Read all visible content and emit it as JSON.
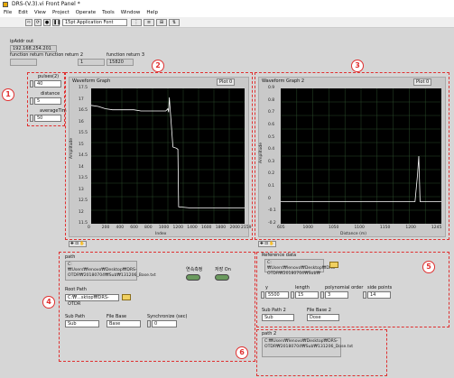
{
  "window": {
    "title": "DRS-(V.3).vi Front Panel *"
  },
  "menu": [
    "File",
    "Edit",
    "View",
    "Project",
    "Operate",
    "Tools",
    "Window",
    "Help"
  ],
  "toolbar": {
    "font_select": "15pt Application Font"
  },
  "ipaddr": {
    "label": "ipAddr out",
    "value": "192.168.254.201"
  },
  "fn_return": {
    "label1": "function return",
    "label2": "function return 2",
    "label3": "function return 3",
    "value2": "1",
    "value3": "15820"
  },
  "controls1": {
    "pulses_label": "pulses(2)",
    "pulses_value": "40",
    "distance_label": "distance",
    "distance_value": "5",
    "avg_label": "averageTim",
    "avg_value": "50"
  },
  "graph1": {
    "title": "Waveform Graph",
    "plot_legend": "Plot 0",
    "xlabel": "Index",
    "ylabel": "Amplitude",
    "yticks": [
      "17.5",
      "17",
      "16.5",
      "16",
      "15.5",
      "15",
      "14.5",
      "14",
      "13.5",
      "13",
      "12.5",
      "12",
      "11.5"
    ],
    "xticks": [
      "0",
      "200",
      "400",
      "600",
      "800",
      "1000",
      "1200",
      "1400",
      "1600",
      "1800",
      "2000",
      "2159"
    ]
  },
  "graph2": {
    "title": "Waveform Graph 2",
    "plot_legend": "Plot 0",
    "xlabel": "Distance (m)",
    "ylabel": "Amplitude",
    "yticks": [
      "0.9",
      "0.8",
      "0.7",
      "0.6",
      "0.5",
      "0.4",
      "0.3",
      "0.2",
      "0.1",
      "0",
      "-0.1",
      "-0.2"
    ],
    "xticks": [
      "605",
      "1000",
      "1050",
      "1100",
      "1150",
      "1200",
      "1245"
    ]
  },
  "chart_data": [
    {
      "type": "line",
      "title": "Waveform Graph",
      "xlabel": "Index",
      "ylabel": "Amplitude",
      "xlim": [
        0,
        2159
      ],
      "ylim": [
        11.5,
        17.5
      ],
      "series": [
        {
          "name": "Plot 0",
          "x": [
            0,
            100,
            200,
            300,
            400,
            500,
            600,
            700,
            800,
            900,
            1000,
            1050,
            1080,
            1090,
            1100,
            1150,
            1200,
            1220,
            1230,
            1400,
            1600,
            1800,
            2000,
            2159
          ],
          "y": [
            16.75,
            16.7,
            16.6,
            16.55,
            16.55,
            16.55,
            16.55,
            16.5,
            16.5,
            16.5,
            16.5,
            16.5,
            16.6,
            16.45,
            17.1,
            14.9,
            14.85,
            14.8,
            12.25,
            12.2,
            12.2,
            12.2,
            12.2,
            12.2
          ]
        }
      ]
    },
    {
      "type": "line",
      "title": "Waveform Graph 2",
      "xlabel": "Distance (m)",
      "ylabel": "Amplitude",
      "xlim": [
        605,
        1245
      ],
      "ylim": [
        -0.2,
        0.9
      ],
      "series": [
        {
          "name": "Plot 0",
          "x": [
            605,
            700,
            800,
            900,
            1000,
            1050,
            1100,
            1140,
            1150,
            1155,
            1160,
            1170,
            1200,
            1245
          ],
          "y": [
            -0.02,
            -0.02,
            -0.02,
            -0.02,
            -0.02,
            -0.02,
            -0.02,
            -0.02,
            0.2,
            0.35,
            -0.02,
            -0.02,
            -0.02,
            -0.02
          ]
        }
      ]
    }
  ],
  "path_section": {
    "path_label": "path",
    "path_value": "C:₩Users₩lenovo₩Desktop₩DRS-OTDR₩20180704₩Sub₩131206_Base.txt",
    "btn1_label": "연속측정",
    "btn2_label": "저장 On",
    "root_label": "Root Path",
    "root_value": "C:₩...sktop₩DRS-OTDR",
    "subpath_label": "Sub Path",
    "subpath_value": "Sub",
    "filebase_label": "File Base",
    "filebase_value": "Base",
    "sync_label": "Synchronize (sec)",
    "sync_value": "0"
  },
  "reference": {
    "label": "Reference data",
    "path_value": "C:₩Users₩lenovo₩Desktop₩DRS-OTDR₩20180704₩Sub₩",
    "y_label": "y",
    "y_value": "5500",
    "length_label": "length",
    "length_value": "15",
    "poly_label": "polynomial order",
    "poly_value": "3",
    "side_label": "side points",
    "side_value": "14",
    "subpath2_label": "Sub Path 2",
    "subpath2_value": "Sub",
    "filebase2_label": "File Base 2",
    "filebase2_value": "Dose"
  },
  "path2": {
    "label": "path 2",
    "value": "C:₩Users₩lenovo₩Desktop₩DRS-OTDR₩20180704₩Sub₩131206_Dose.txt"
  },
  "markers": [
    "1",
    "2",
    "3",
    "4",
    "5",
    "6"
  ],
  "colors": {
    "annotation": "#e03030",
    "plot_bg": "#000000",
    "trace": "#ffffff",
    "grid": "#2a4a2a"
  }
}
